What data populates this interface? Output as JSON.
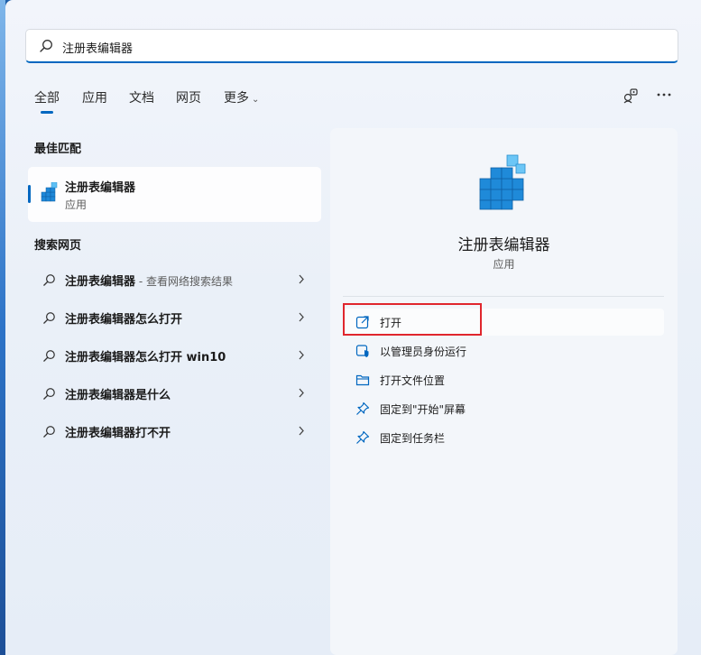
{
  "search": {
    "value": "注册表编辑器"
  },
  "tabs": [
    {
      "label": "全部"
    },
    {
      "label": "应用"
    },
    {
      "label": "文档"
    },
    {
      "label": "网页"
    },
    {
      "label": "更多"
    }
  ],
  "best_match": {
    "heading": "最佳匹配",
    "name": "注册表编辑器",
    "type": "应用"
  },
  "web_search": {
    "heading": "搜索网页",
    "items": [
      {
        "text": "注册表编辑器",
        "hint": " - 查看网络搜索结果"
      },
      {
        "text": "注册表编辑器怎么打开",
        "hint": ""
      },
      {
        "text": "注册表编辑器怎么打开 win10",
        "hint": ""
      },
      {
        "text": "注册表编辑器是什么",
        "hint": ""
      },
      {
        "text": "注册表编辑器打不开",
        "hint": ""
      }
    ]
  },
  "detail": {
    "title": "注册表编辑器",
    "subtitle": "应用",
    "actions": [
      {
        "label": "打开",
        "icon": "open-external-icon"
      },
      {
        "label": "以管理员身份运行",
        "icon": "admin-shield-icon"
      },
      {
        "label": "打开文件位置",
        "icon": "folder-icon"
      },
      {
        "label": "固定到\"开始\"屏幕",
        "icon": "pin-icon"
      },
      {
        "label": "固定到任务栏",
        "icon": "pin-icon"
      }
    ]
  },
  "colors": {
    "accent": "#0067c0",
    "highlight_box": "#e0262d"
  }
}
